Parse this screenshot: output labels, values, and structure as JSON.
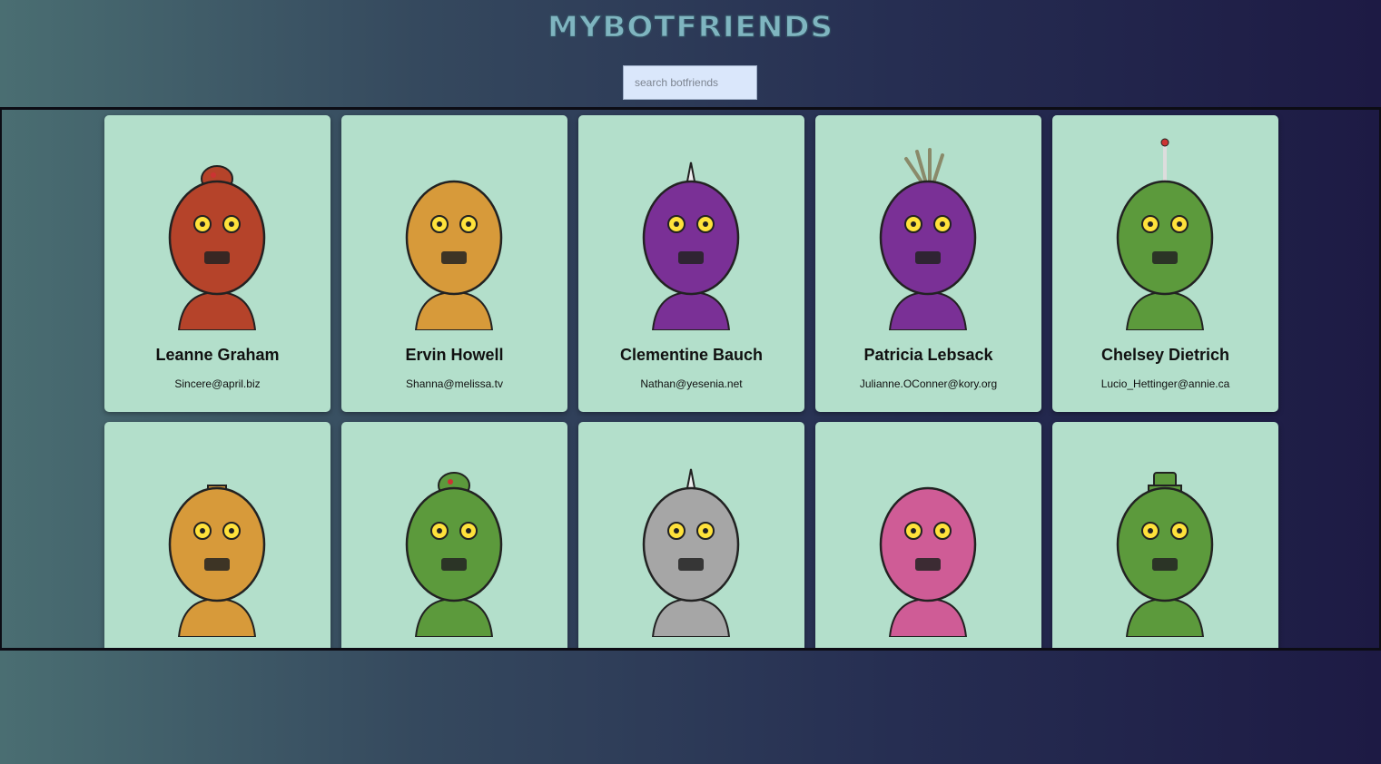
{
  "header": {
    "title": "MYBOTFRIENDS"
  },
  "search": {
    "placeholder": "search botfriends",
    "value": ""
  },
  "robots": [
    {
      "name": "Leanne Graham",
      "email": "Sincere@april.biz",
      "color": "#b5432a",
      "top": "knob"
    },
    {
      "name": "Ervin Howell",
      "email": "Shanna@melissa.tv",
      "color": "#d79a3a",
      "top": "none"
    },
    {
      "name": "Clementine Bauch",
      "email": "Nathan@yesenia.net",
      "color": "#7a3096",
      "top": "spike"
    },
    {
      "name": "Patricia Lebsack",
      "email": "Julianne.OConner@kory.org",
      "color": "#7a3096",
      "top": "feather"
    },
    {
      "name": "Chelsey Dietrich",
      "email": "Lucio_Hettinger@annie.ca",
      "color": "#5c9a3c",
      "top": "antenna"
    },
    {
      "name": "",
      "email": "",
      "color": "#d79a3a",
      "top": "box"
    },
    {
      "name": "",
      "email": "",
      "color": "#5c9a3c",
      "top": "knob"
    },
    {
      "name": "",
      "email": "",
      "color": "#a6a6a6",
      "top": "spike"
    },
    {
      "name": "",
      "email": "",
      "color": "#cf5c96",
      "top": "none"
    },
    {
      "name": "",
      "email": "",
      "color": "#5c9a3c",
      "top": "hat"
    }
  ]
}
